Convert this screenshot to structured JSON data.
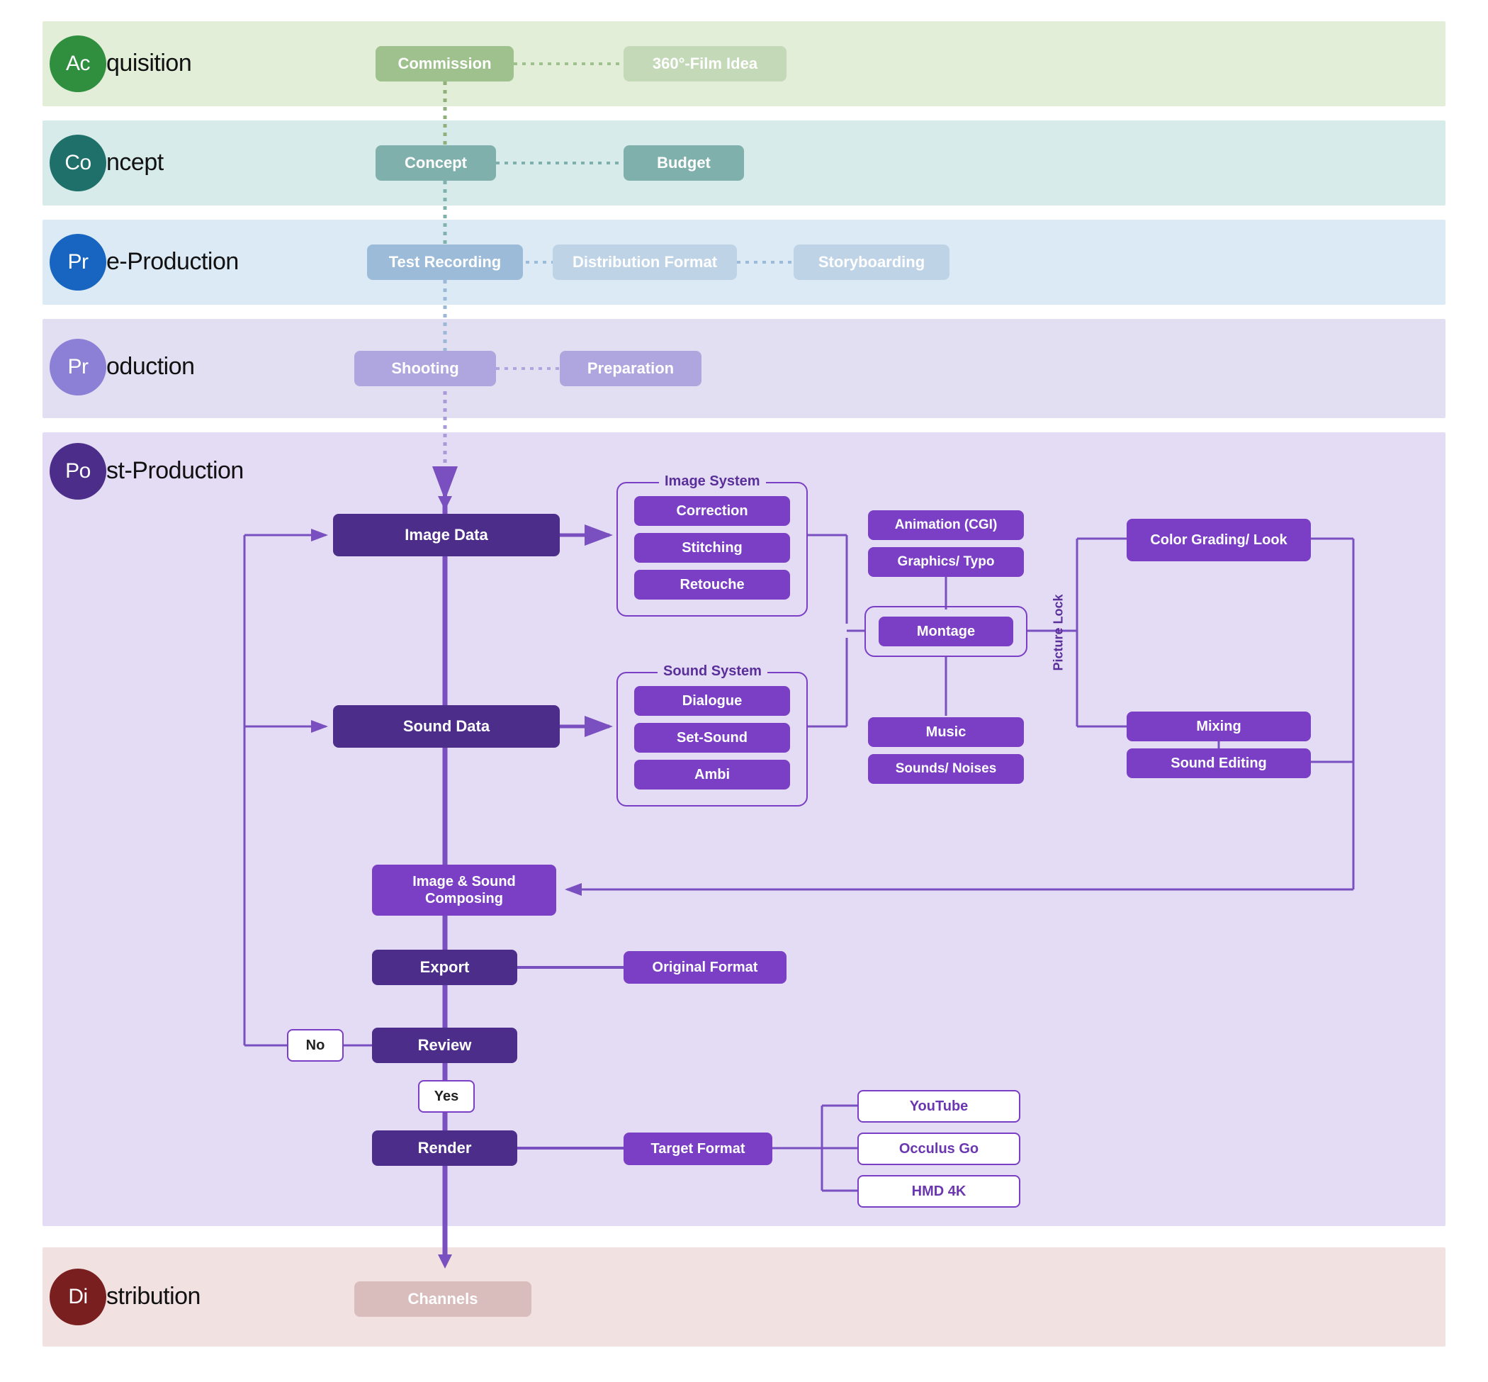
{
  "phases": {
    "acquisition": {
      "abbrev": "Ac",
      "title": "quisition"
    },
    "concept": {
      "abbrev": "Co",
      "title": "ncept"
    },
    "preprod": {
      "abbrev": "Pr",
      "title": "e-Production"
    },
    "production": {
      "abbrev": "Pr",
      "title": "oduction"
    },
    "postprod": {
      "abbrev": "Po",
      "title": "st-Production"
    },
    "distribution": {
      "abbrev": "Di",
      "title": "stribution"
    }
  },
  "nodes": {
    "commission": "Commission",
    "film_idea": "360°-Film Idea",
    "concept": "Concept",
    "budget": "Budget",
    "test_recording": "Test Recording",
    "dist_format": "Distribution Format",
    "storyboarding": "Storyboarding",
    "shooting": "Shooting",
    "preparation": "Preparation",
    "image_data": "Image Data",
    "sound_data": "Sound Data",
    "image_system_label": "Image System",
    "correction": "Correction",
    "stitching": "Stitching",
    "retouche": "Retouche",
    "sound_system_label": "Sound System",
    "dialogue": "Dialogue",
    "set_sound": "Set-Sound",
    "ambi": "Ambi",
    "animation": "Animation (CGI)",
    "graphics_typo": "Graphics/ Typo",
    "montage": "Montage",
    "music": "Music",
    "sounds_noises": "Sounds/ Noises",
    "picture_lock": "Picture Lock",
    "color_grading": "Color Grading/ Look",
    "mixing": "Mixing",
    "sound_editing": "Sound Editing",
    "composing": "Image & Sound Composing",
    "export": "Export",
    "original_format": "Original Format",
    "review": "Review",
    "no": "No",
    "yes": "Yes",
    "render": "Render",
    "target_format": "Target Format",
    "youtube": "YouTube",
    "occulus": "Occulus Go",
    "hmd4k": "HMD 4K",
    "channels": "Channels"
  },
  "colors": {
    "acqBand": "#e3eed8",
    "acqCircle": "#2f8f3f",
    "acqNode": "#9fc18d",
    "acqNodeFaded": "#c4d9b8",
    "conBand": "#d7ecea",
    "conCircle": "#1f6f6a",
    "conNode": "#80b0ac",
    "preBand": "#dceaf5",
    "preCircle": "#1765c0",
    "preNode": "#9cbbd8",
    "preNodeFaded": "#bfd3e6",
    "prodBand": "#e3dff2",
    "prodCircle": "#8c7fd6",
    "prodNode": "#b0a6df",
    "postBand": "#e3dcf4",
    "postCircle": "#4c2e8a",
    "distBand": "#f2e1e1",
    "distCircle": "#7a1f1f",
    "distNode": "#d9bcbc"
  }
}
